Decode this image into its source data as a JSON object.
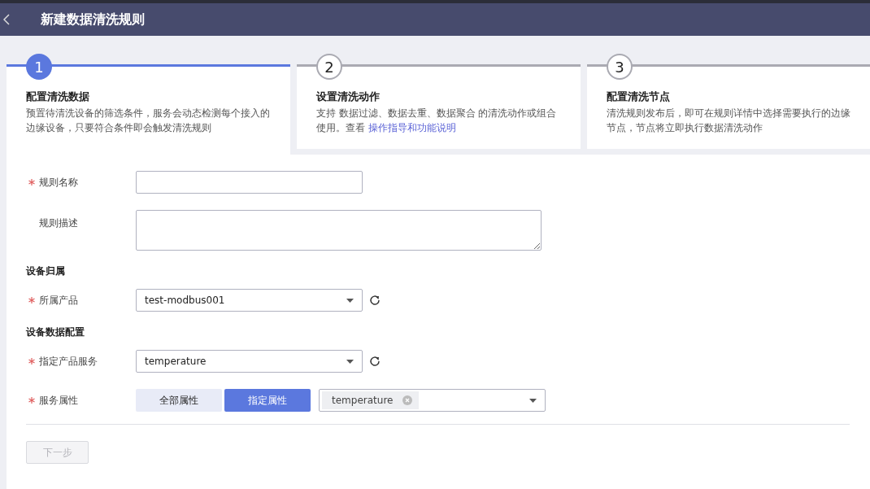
{
  "header": {
    "title": "新建数据清洗规则"
  },
  "steps": [
    {
      "number": "1",
      "title": "配置清洗数据",
      "description": "预置待清洗设备的筛选条件，服务会动态检测每个接入的边缘设备，只要符合条件即会触发清洗规则",
      "selected": true
    },
    {
      "number": "2",
      "title": "设置清洗动作",
      "description": "支持 数据过滤、数据去重、数据聚合 的清洗动作或组合使用。查看 ",
      "link": "操作指导和功能说明",
      "selected": false
    },
    {
      "number": "3",
      "title": "配置清洗节点",
      "description": "清洗规则发布后，即可在规则详情中选择需要执行的边缘节点，节点将立即执行数据清洗动作",
      "selected": false
    }
  ],
  "form": [
    {
      "kind": "input",
      "label": "规则名称",
      "required": true
    },
    {
      "kind": "textarea",
      "label": "规则描述",
      "required": false
    },
    {
      "kind": "section",
      "label": "设备归属"
    },
    {
      "kind": "select",
      "label": "所属产品",
      "required": true,
      "value": "test-modbus001"
    },
    {
      "kind": "section",
      "label": "设备数据配置"
    },
    {
      "kind": "select",
      "label": "指定产品服务",
      "required": true,
      "value": "temperature"
    },
    {
      "kind": "segmented",
      "label": "服务属性",
      "required": true,
      "options": [
        {
          "label": "全部属性",
          "selected": false
        },
        {
          "label": "指定属性",
          "selected": true
        }
      ],
      "tags": [
        "temperature"
      ]
    }
  ],
  "next_button": {
    "label": "下一步",
    "disabled": true
  }
}
